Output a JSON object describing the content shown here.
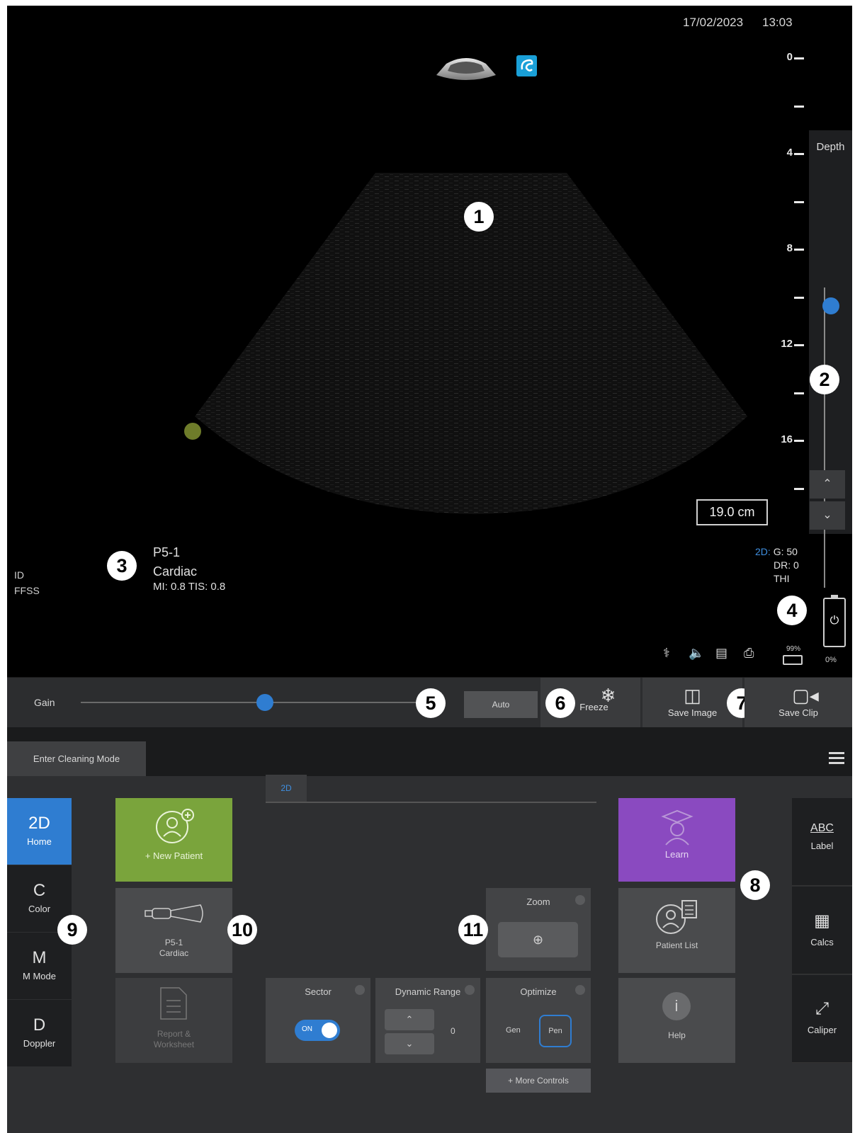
{
  "header": {
    "date": "17/02/2023",
    "time": "13:03"
  },
  "depth_scale": {
    "labels": [
      "0",
      "",
      "4",
      "",
      "8",
      "",
      "12",
      "",
      "16",
      ""
    ],
    "title": "Depth",
    "value": "19.0 cm",
    "up_icon": "chevron-up-icon",
    "down_icon": "chevron-down-icon"
  },
  "image_params": {
    "mode": "2D:",
    "gain": "G: 50",
    "dynamic_range": "DR: 0",
    "thi": "THI"
  },
  "probe": {
    "name": "P5-1",
    "preset": "Cardiac",
    "indices": "MI: 0.8 TIS: 0.8"
  },
  "patient": {
    "id": "ID",
    "ffss": "FFSS"
  },
  "status": {
    "disk_pct": "99%",
    "battery_pct": "0%"
  },
  "control_bar": {
    "gain_label": "Gain",
    "gain_level": 0.51,
    "auto_label": "Auto",
    "freeze_label": "Freeze",
    "save_image_label": "Save Image",
    "save_clip_label": "Save Clip"
  },
  "cleaning_mode_label": "Enter Cleaning Mode",
  "tab": {
    "label": "2D"
  },
  "modes": [
    {
      "big": "2D",
      "label": "Home"
    },
    {
      "big": "C",
      "label": "Color"
    },
    {
      "big": "M",
      "label": "M Mode"
    },
    {
      "big": "D",
      "label": "Doppler"
    }
  ],
  "tiles": {
    "new_patient": "+ New Patient",
    "probe_line1": "P5-1",
    "probe_line2": "Cardiac",
    "report_line1": "Report &",
    "report_line2": "Worksheet",
    "learn": "Learn",
    "patient_list": "Patient List",
    "help": "Help"
  },
  "controls": {
    "zoom": "Zoom",
    "sector": "Sector",
    "sector_toggle": "ON",
    "dynamic_range": "Dynamic Range",
    "dynamic_range_value": "0",
    "optimize": "Optimize",
    "opt_gen": "Gen",
    "opt_pen": "Pen",
    "more_controls": "+ More Controls"
  },
  "tools": {
    "label": "Label",
    "label_icon": "ABC",
    "calcs": "Calcs",
    "caliper": "Caliper"
  },
  "callouts": [
    "1",
    "2",
    "3",
    "4",
    "5",
    "6",
    "7",
    "8",
    "9",
    "10",
    "11"
  ],
  "colors": {
    "accent_blue": "#2f7dd1",
    "new_patient_green": "#7aa43c",
    "learn_purple": "#8a4ac0"
  }
}
